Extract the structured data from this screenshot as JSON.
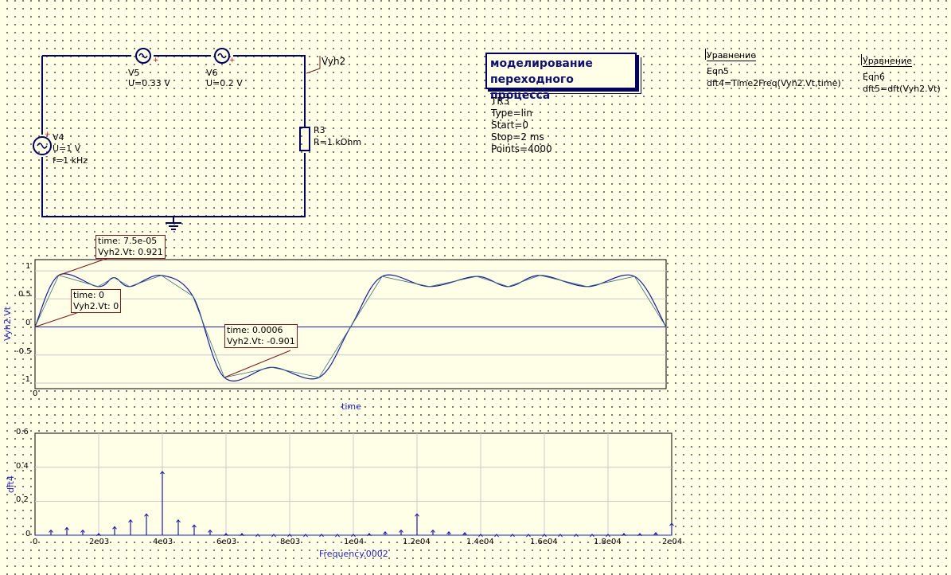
{
  "schematic": {
    "title_line1": "моделирование",
    "title_line2": "переходного процесса",
    "v5": {
      "name": "V5",
      "value": "U=0.33 V"
    },
    "v6": {
      "name": "V6",
      "value": "U=0.2 V"
    },
    "v4": {
      "name": "V4",
      "value": "U=1 V",
      "freq": "f=1 kHz",
      "plus": "+",
      "minus": "-"
    },
    "r3": {
      "name": "R3",
      "value": "R=1 kOhm"
    },
    "node_label": "Vyh2",
    "tr3": {
      "name": "TR3",
      "type": "Type=lin",
      "start": "Start=0",
      "stop": "Stop=2 ms",
      "points": "Points=4000"
    },
    "eqn5": {
      "header": "Уравнение",
      "name": "Eqn5",
      "expr": "dft4=Time2Freq(Vyh2.Vt,time)"
    },
    "eqn6": {
      "header": "Уравнение",
      "name": "Eqn6",
      "expr": "dft5=dft(Vyh2.Vt)"
    }
  },
  "transient_plot": {
    "ylabel": "Vyh2.Vt",
    "xlabel": "time",
    "x_tick_0": "0",
    "y_ticks": [
      "1",
      "0.5",
      "0",
      "-0.5",
      "-1"
    ],
    "markers": [
      {
        "line1": "time: 7.5e-05",
        "line2": "Vyh2.Vt: 0.921"
      },
      {
        "line1": "time: 0",
        "line2": "Vyh2.Vt: 0"
      },
      {
        "line1": "time: 0.0006",
        "line2": "Vyh2.Vt: -0.901"
      }
    ]
  },
  "dft_plot": {
    "ylabel": "dft4",
    "xlabel": "Frequency.0002",
    "y_ticks": [
      "0.6",
      "0.4",
      "0.2",
      "0"
    ],
    "x_ticks": [
      "0",
      "2e03",
      "4e03",
      "6e03",
      "8e03",
      "1e04",
      "1.2e04",
      "1.4e04",
      "1.6e04",
      "1.8e04",
      "2e04"
    ]
  },
  "chart_data": [
    {
      "type": "line",
      "title": "",
      "xlabel": "time",
      "ylabel": "Vyh2.Vt",
      "xlim": [
        0,
        0.002
      ],
      "ylim": [
        -1.1,
        1.2
      ],
      "grid": true,
      "series": [
        {
          "name": "Vyh2.Vt",
          "x": [
            0,
            7.5e-05,
            0.0002,
            0.00025,
            0.0003,
            0.0004,
            0.0005,
            0.0006,
            0.00075,
            0.0009,
            0.001,
            0.0011,
            0.00125,
            0.0014,
            0.0015,
            0.0016,
            0.00175,
            0.0019,
            0.002
          ],
          "y": [
            0,
            0.921,
            0.72,
            0.88,
            0.72,
            0.92,
            0.55,
            -0.901,
            -0.72,
            -0.9,
            0,
            0.9,
            0.72,
            0.9,
            0.72,
            0.92,
            0.72,
            0.9,
            0
          ]
        }
      ],
      "markers": [
        {
          "x": 7.5e-05,
          "y": 0.921
        },
        {
          "x": 0,
          "y": 0
        },
        {
          "x": 0.0006,
          "y": -0.901
        }
      ]
    },
    {
      "type": "bar",
      "title": "",
      "xlabel": "Frequency.0002",
      "ylabel": "dft4",
      "xlim": [
        0,
        20000
      ],
      "ylim": [
        0,
        0.6
      ],
      "grid": true,
      "series": [
        {
          "name": "dft4",
          "x": [
            500,
            1000,
            1500,
            2000,
            2500,
            3000,
            3500,
            4000,
            4500,
            5000,
            5500,
            6000,
            6500,
            7000,
            7500,
            8000,
            8500,
            9000,
            9500,
            10000,
            10500,
            11000,
            11500,
            12000,
            12500,
            13000,
            13500,
            14000,
            14500,
            15000,
            15500,
            16000,
            16500,
            17000,
            17500,
            18000,
            18500,
            19000,
            19500,
            20000
          ],
          "y": [
            0.03,
            0.045,
            0.03,
            0.01,
            0.05,
            0.09,
            0.125,
            0.375,
            0.09,
            0.06,
            0.03,
            0.01,
            0.01,
            0.005,
            0.005,
            0.005,
            0.005,
            0.005,
            0.005,
            0.005,
            0.01,
            0.02,
            0.03,
            0.125,
            0.03,
            0.02,
            0.015,
            0.005,
            0.005,
            0.005,
            0.005,
            0.005,
            0.005,
            0.005,
            0.005,
            0.005,
            0.01,
            0.01,
            0.015,
            0.07
          ]
        }
      ]
    }
  ]
}
